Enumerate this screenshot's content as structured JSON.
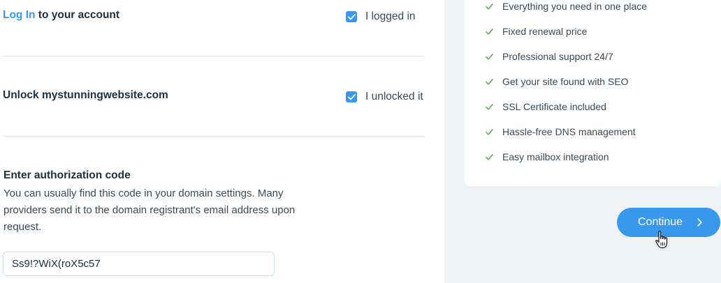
{
  "steps": {
    "login": {
      "link_text": "Log In",
      "title_rest": " to your account",
      "checkbox_label": "I logged in",
      "checked": true
    },
    "unlock": {
      "title": "Unlock mystunningwebsite.com",
      "checkbox_label": "I unlocked it",
      "checked": true
    }
  },
  "auth": {
    "heading": "Enter authorization code",
    "description": "You can usually find this code in your domain settings. Many providers send it to the domain registrant's email address upon request.",
    "value": "Ss9!?WiX(roX5c57"
  },
  "features": [
    {
      "text": "Everything you need in one place",
      "icon": "check-icon"
    },
    {
      "text": "Fixed renewal price",
      "icon": "check-icon"
    },
    {
      "text": "Professional support 24/7",
      "icon": "check-icon"
    },
    {
      "text": "Get your site found with SEO",
      "icon": "check-icon"
    },
    {
      "text": "SSL Certificate included",
      "icon": "check-icon"
    },
    {
      "text": "Hassle-free DNS management",
      "icon": "check-icon"
    },
    {
      "text": "Easy mailbox integration",
      "icon": "check-icon"
    }
  ],
  "continue_button": {
    "label": "Continue",
    "icon": "chevron-right-icon"
  },
  "colors": {
    "accent": "#3899ec",
    "check_green": "#60bc57",
    "right_background": "#eff3f5",
    "divider": "#dfe5eb"
  }
}
